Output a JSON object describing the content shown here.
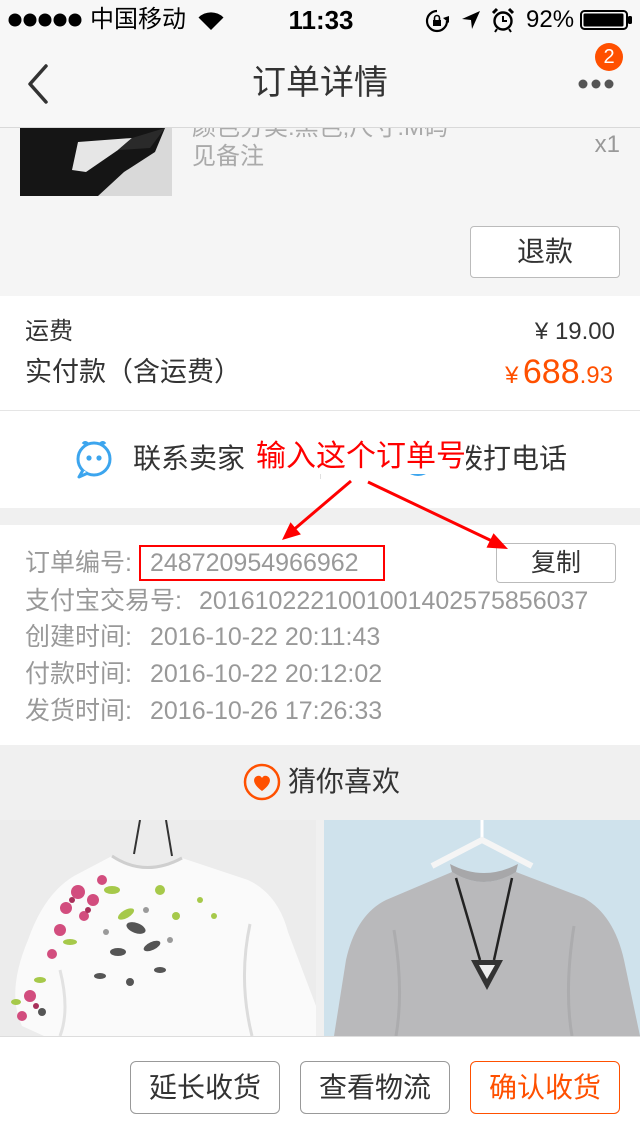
{
  "status_bar": {
    "carrier": "中国移动",
    "time": "11:33",
    "battery": "92%",
    "icons": [
      "signal-strength-icon",
      "wifi-icon",
      "orientation-lock-icon",
      "location-icon",
      "alarm-icon",
      "battery-icon"
    ]
  },
  "nav": {
    "title": "订单详情",
    "more_badge": "2",
    "icons": {
      "back": "chevron-left-icon",
      "more": "more-dots-icon"
    }
  },
  "product": {
    "spec": "颜色分类:黑色;尺寸:M码",
    "note": "见备注",
    "quantity": "x1",
    "refund_label": "退款"
  },
  "payment": {
    "shipping_label": "运费",
    "shipping_value": "¥ 19.00",
    "total_label": "实付款（含运费）",
    "total_currency": "¥",
    "total_integer": "688",
    "total_decimal": ".93"
  },
  "contact": {
    "seller_label": "联系卖家",
    "call_label": "拨打电话",
    "icons": {
      "seller": "chat-bubble-icon",
      "call": "phone-icon"
    }
  },
  "annotation": {
    "text": "输入这个订单号"
  },
  "order_info": {
    "copy_label": "复制",
    "rows": [
      {
        "label": "订单编号:",
        "value": "248720954966962"
      },
      {
        "label": "支付宝交易号:",
        "value": "2016102221001001402575856037"
      },
      {
        "label": "创建时间:",
        "value": "2016-10-22 20:11:43"
      },
      {
        "label": "付款时间:",
        "value": "2016-10-22 20:12:02"
      },
      {
        "label": "发货时间:",
        "value": "2016-10-26 17:26:33"
      }
    ]
  },
  "recommend": {
    "title": "猜你喜欢",
    "icon": "heart-icon"
  },
  "bottom_bar": {
    "extend_label": "延长收货",
    "logistics_label": "查看物流",
    "confirm_label": "确认收货"
  },
  "colors": {
    "accent": "#ff5000",
    "annotation": "#ff0000",
    "link_blue": "#3ca5ee",
    "muted_text": "#999999"
  }
}
